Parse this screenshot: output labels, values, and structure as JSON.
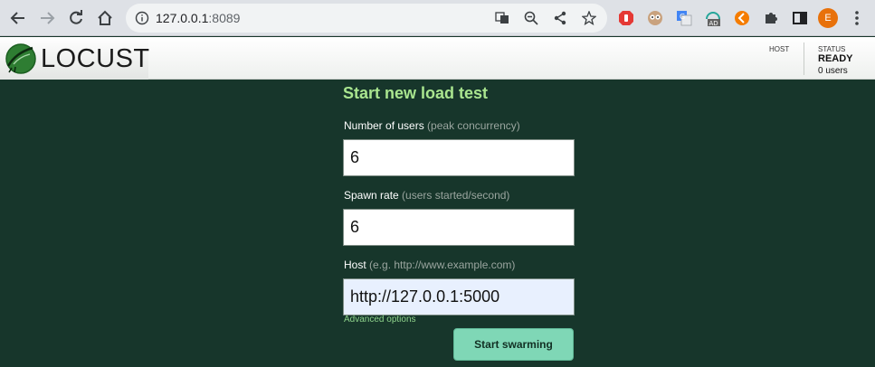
{
  "browser": {
    "url_host": "127.0.0.1",
    "url_port": ":8089",
    "profile_initial": "E"
  },
  "header": {
    "logo_text": "LOCUST",
    "host_label": "HOST",
    "status_label": "STATUS",
    "status_value": "READY",
    "users_value": "0 users"
  },
  "form": {
    "title": "Start new load test",
    "users": {
      "label": "Number of users",
      "hint": "(peak concurrency)",
      "value": "6"
    },
    "spawn": {
      "label": "Spawn rate",
      "hint": "(users started/second)",
      "value": "6"
    },
    "host": {
      "label": "Host",
      "hint": "(e.g. http://www.example.com)",
      "value": "http://127.0.0.1:5000"
    },
    "advanced_label": "Advanced options",
    "start_label": "Start swarming"
  },
  "colors": {
    "page_bg": "#17362b",
    "title": "#a9e58f",
    "button": "#7fd7b6",
    "link": "#8ed38b"
  }
}
